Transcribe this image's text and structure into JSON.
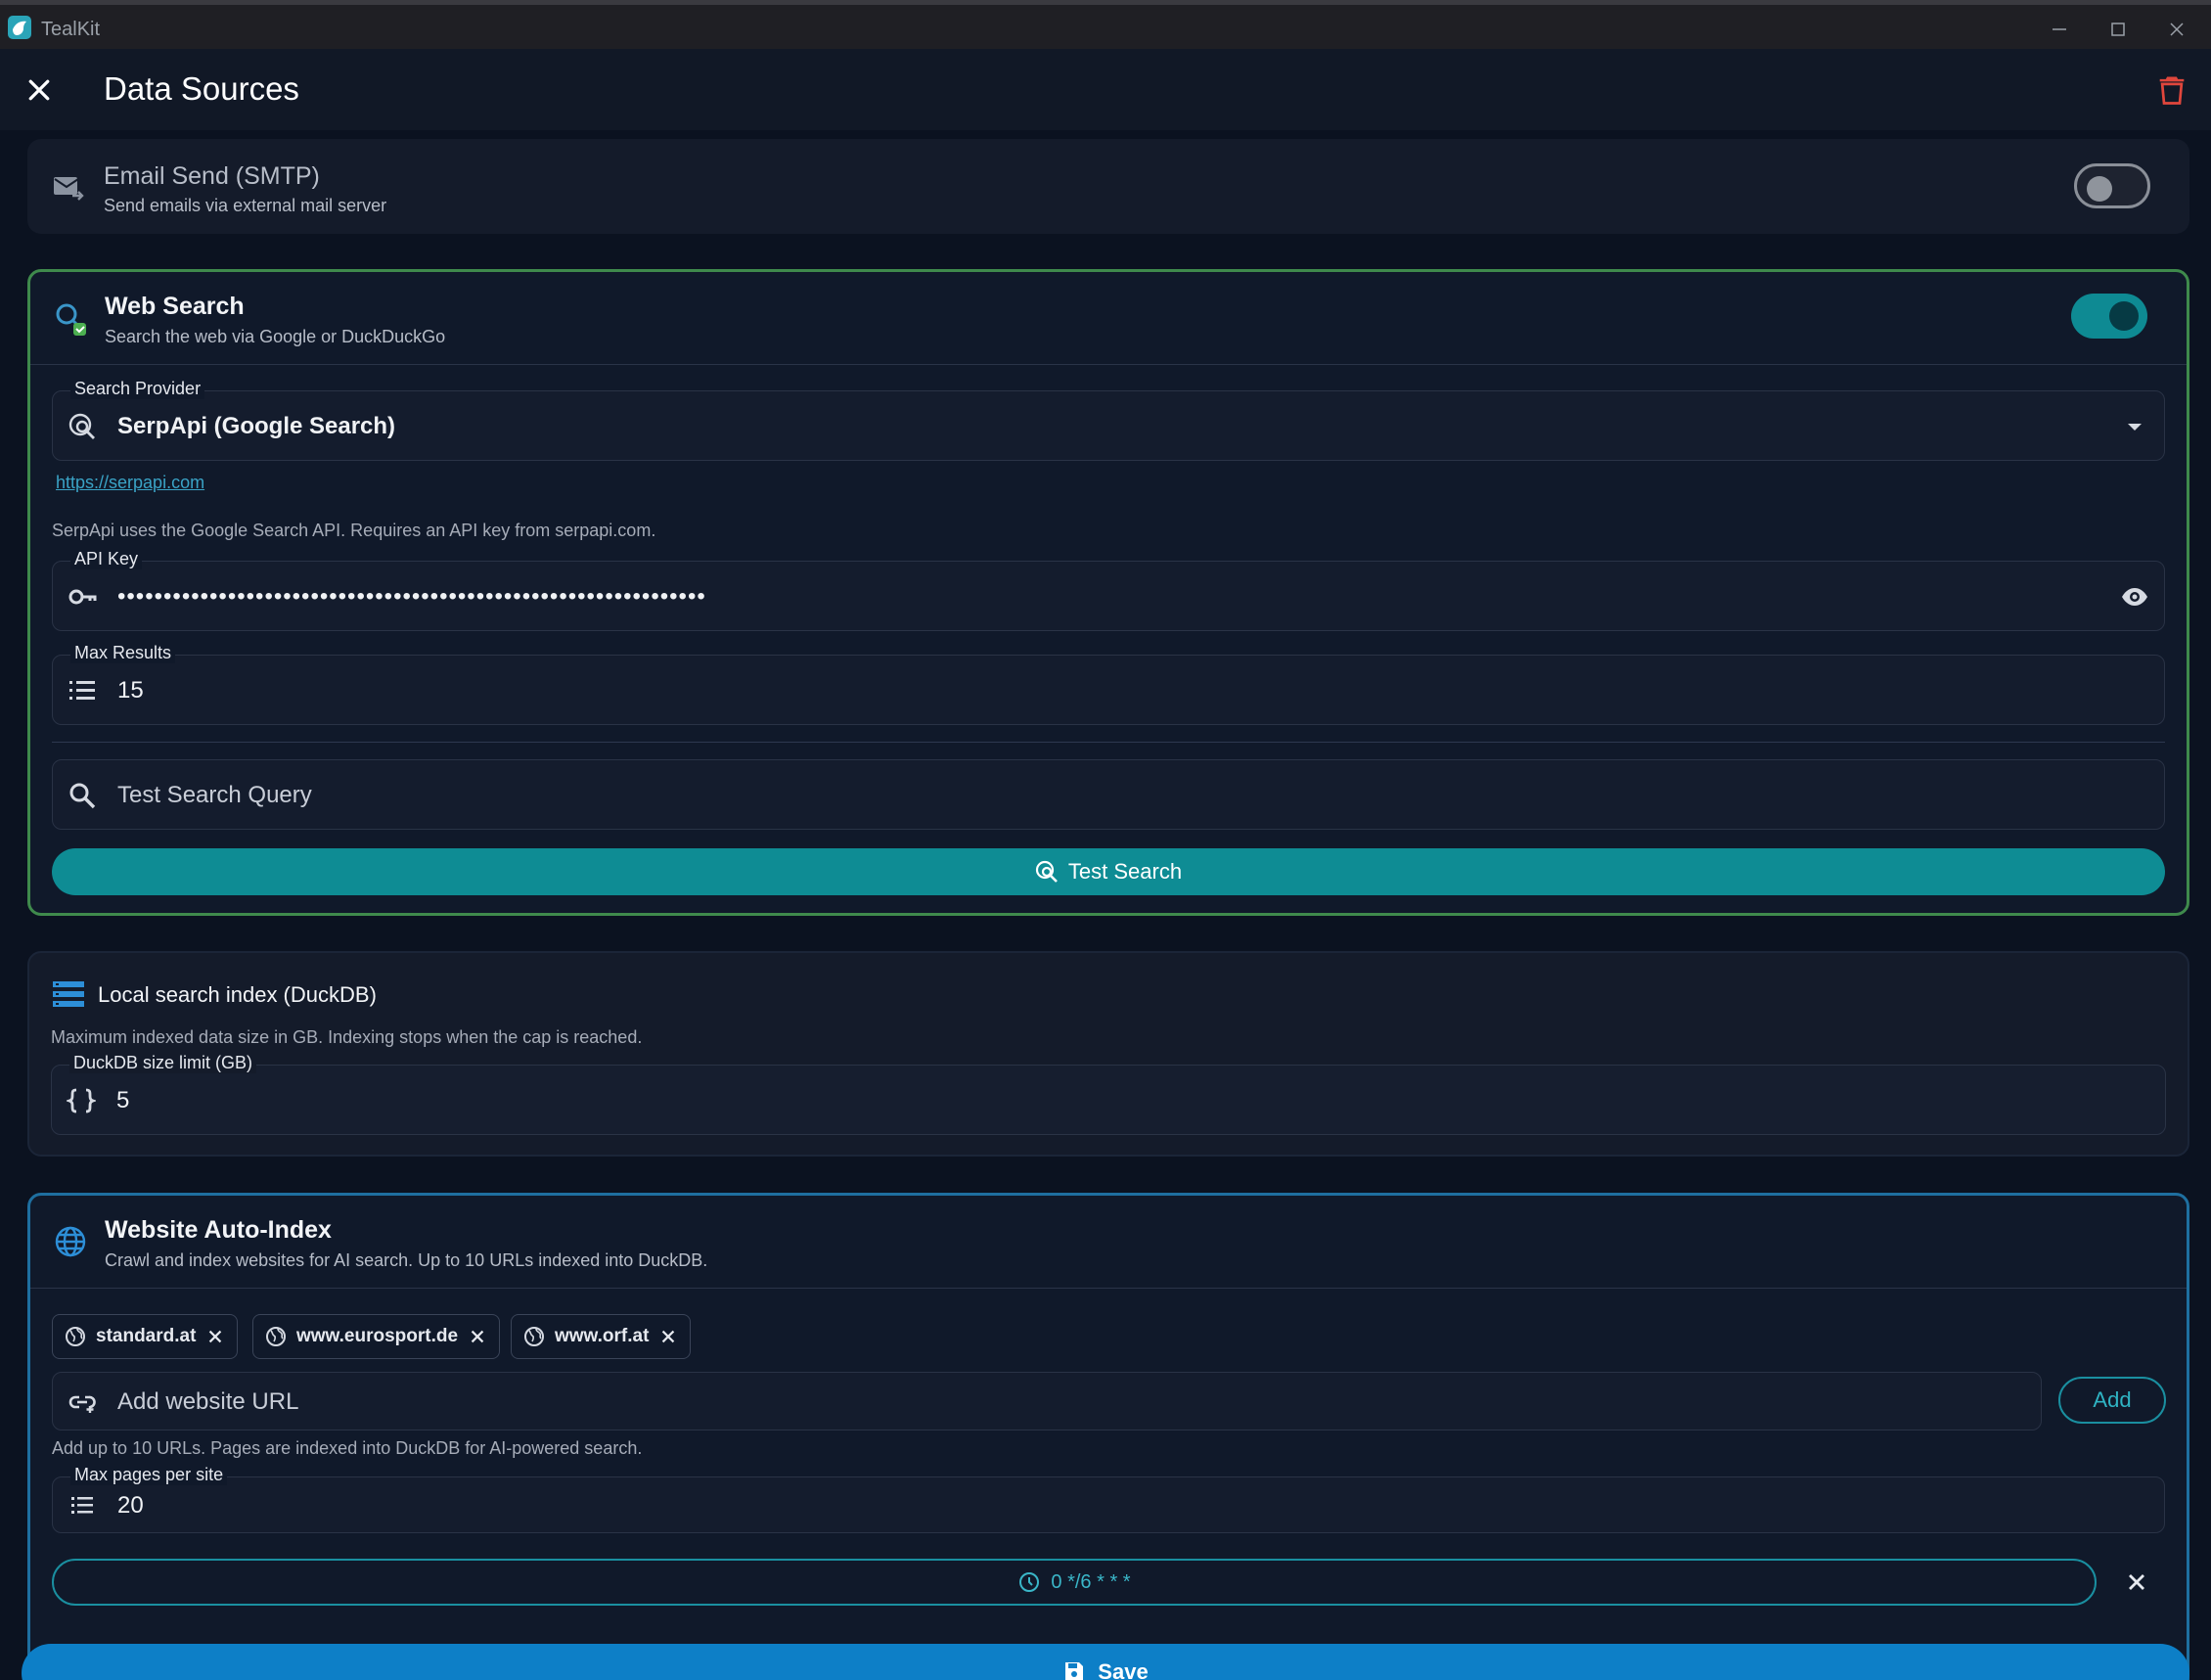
{
  "window": {
    "title": "TealKit"
  },
  "header": {
    "title": "Data Sources"
  },
  "smtp": {
    "title": "Email Send (SMTP)",
    "subtitle": "Send emails via external mail server",
    "enabled": false
  },
  "web_search": {
    "title": "Web Search",
    "subtitle": "Search the web via Google or DuckDuckGo",
    "enabled": true,
    "provider_label": "Search Provider",
    "provider_value": "SerpApi (Google Search)",
    "provider_link": "https://serpapi.com",
    "provider_help": "SerpApi uses the Google Search API. Requires an API key from serpapi.com.",
    "api_key_label": "API Key",
    "api_key_value": "••••••••••••••••••••••••••••••••••••••••••••••••••••••••••••••••",
    "max_results_label": "Max Results",
    "max_results_value": "15",
    "test_query_placeholder": "Test Search Query",
    "test_button": "Test Search"
  },
  "duckdb": {
    "title": "Local search index (DuckDB)",
    "help": "Maximum indexed data size in GB. Indexing stops when the cap is reached.",
    "size_label": "DuckDB size limit (GB)",
    "size_value": "5"
  },
  "auto_index": {
    "title": "Website Auto-Index",
    "subtitle": "Crawl and index websites for AI search. Up to 10 URLs indexed into DuckDB.",
    "sites": [
      "standard.at",
      "www.eurosport.de",
      "www.orf.at"
    ],
    "url_placeholder": "Add website URL",
    "add_button": "Add",
    "url_help": "Add up to 10 URLs. Pages are indexed into DuckDB for AI-powered search.",
    "max_pages_label": "Max pages per site",
    "max_pages_value": "20",
    "cron": "0 */6 * * *"
  },
  "footer": {
    "save_button": "Save"
  },
  "colors": {
    "accent": "#0e8c94",
    "save": "#0d7fc7",
    "danger": "#e0463c",
    "web_border": "#3f8a4c",
    "site_border": "#1e6fa0"
  }
}
